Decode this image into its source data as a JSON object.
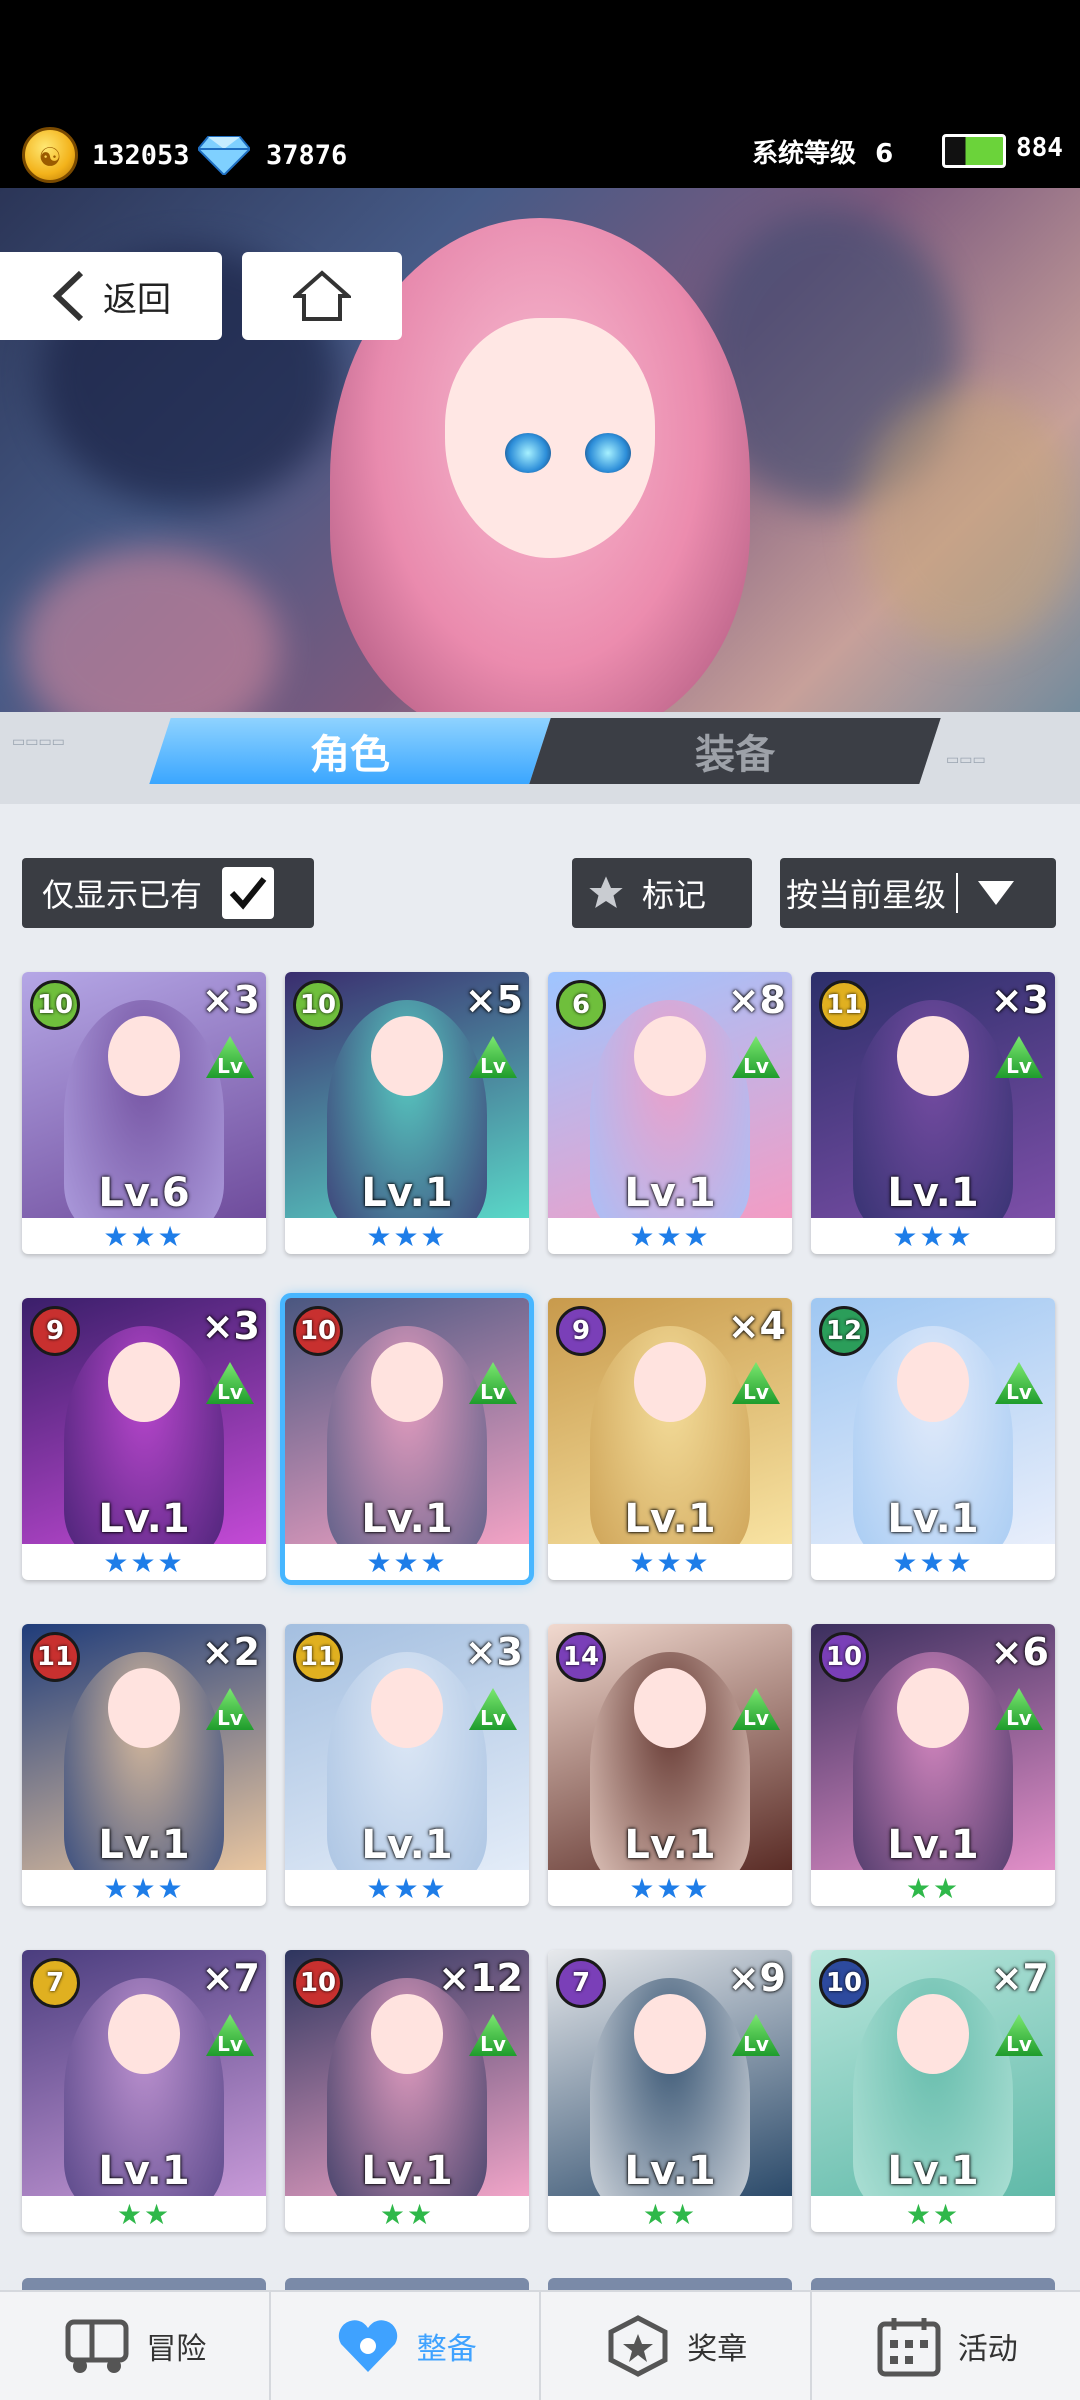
{
  "resources": {
    "gold": "132053",
    "diamonds": "37876",
    "system_level_label": "系统等级",
    "system_level": "6",
    "energy": "884"
  },
  "nav_buttons": {
    "back_label": "返回"
  },
  "tabs": [
    {
      "label": "角色",
      "active": true
    },
    {
      "label": "装备",
      "active": false
    }
  ],
  "filters": {
    "owned_only_label": "仅显示已有",
    "owned_only_checked": true,
    "mark_label": "标记",
    "sort_label": "按当前星级"
  },
  "characters": [
    {
      "level": "10",
      "count": "×3",
      "lv": "Lv.6",
      "stars": "★★★",
      "star_color": "#1e7de8",
      "badge_color": "#6fbf3c",
      "palette": [
        "#b5a7e6",
        "#6f4c9c"
      ]
    },
    {
      "level": "10",
      "count": "×5",
      "lv": "Lv.1",
      "stars": "★★★",
      "star_color": "#1e7de8",
      "badge_color": "#6fbf3c",
      "palette": [
        "#3a2d6e",
        "#5ad8c8"
      ]
    },
    {
      "level": "6",
      "count": "×8",
      "lv": "Lv.1",
      "stars": "★★★",
      "star_color": "#1e7de8",
      "badge_color": "#6fbf3c",
      "palette": [
        "#9ec5ff",
        "#f39cc4"
      ]
    },
    {
      "level": "11",
      "count": "×3",
      "lv": "Lv.1",
      "stars": "★★★",
      "star_color": "#1e7de8",
      "badge_color": "#e0b020",
      "palette": [
        "#2c2f6a",
        "#7d4fa8"
      ]
    },
    {
      "level": "9",
      "count": "×3",
      "lv": "Lv.1",
      "stars": "★★★",
      "star_color": "#1e7de8",
      "badge_color": "#c8302f",
      "palette": [
        "#3a1f6a",
        "#c44ad6"
      ]
    },
    {
      "level": "10",
      "count": "",
      "lv": "Lv.1",
      "stars": "★★★",
      "star_color": "#1e7de8",
      "badge_color": "#c8302f",
      "palette": [
        "#4a5780",
        "#f3a3c5"
      ],
      "selected": true
    },
    {
      "level": "9",
      "count": "×4",
      "lv": "Lv.1",
      "stars": "★★★",
      "star_color": "#1e7de8",
      "badge_color": "#7a3fb8",
      "palette": [
        "#c89a4c",
        "#f8e3a2"
      ]
    },
    {
      "level": "12",
      "count": "",
      "lv": "Lv.1",
      "stars": "★★★",
      "star_color": "#1e7de8",
      "badge_color": "#2b9e5a",
      "palette": [
        "#9fc7f2",
        "#e8eefb"
      ]
    },
    {
      "level": "11",
      "count": "×2",
      "lv": "Lv.1",
      "stars": "★★★",
      "star_color": "#1e7de8",
      "badge_color": "#c8302f",
      "palette": [
        "#1f3c7a",
        "#e9c6a0"
      ]
    },
    {
      "level": "11",
      "count": "×3",
      "lv": "Lv.1",
      "stars": "★★★",
      "star_color": "#1e7de8",
      "badge_color": "#e0b020",
      "palette": [
        "#a4bfe0",
        "#e3ecf8"
      ]
    },
    {
      "level": "14",
      "count": "",
      "lv": "Lv.1",
      "stars": "★★★",
      "star_color": "#1e7de8",
      "badge_color": "#7a3fb8",
      "palette": [
        "#f1d9cf",
        "#5a2c26"
      ]
    },
    {
      "level": "10",
      "count": "×6",
      "lv": "Lv.1",
      "stars": "★★",
      "star_color": "#2fb84a",
      "badge_color": "#7a3fb8",
      "palette": [
        "#3b2f5e",
        "#e28fc8"
      ]
    },
    {
      "level": "7",
      "count": "×7",
      "lv": "Lv.1",
      "stars": "★★",
      "star_color": "#2fb84a",
      "badge_color": "#e0b020",
      "palette": [
        "#4a3d7e",
        "#c89ad8"
      ]
    },
    {
      "level": "10",
      "count": "×12",
      "lv": "Lv.1",
      "stars": "★★",
      "star_color": "#2fb84a",
      "badge_color": "#c8302f",
      "palette": [
        "#2d355e",
        "#f1a5c8"
      ]
    },
    {
      "level": "7",
      "count": "×9",
      "lv": "Lv.1",
      "stars": "★★",
      "star_color": "#2fb84a",
      "badge_color": "#7a3fb8",
      "palette": [
        "#e7e9ec",
        "#2b4a6a"
      ]
    },
    {
      "level": "10",
      "count": "×7",
      "lv": "Lv.1",
      "stars": "★★",
      "star_color": "#2fb84a",
      "badge_color": "#2d4a9e",
      "palette": [
        "#b9e6dc",
        "#5fb9a8"
      ]
    }
  ],
  "bottom_nav": [
    {
      "label": "冒险",
      "icon": "truck-icon",
      "active": false
    },
    {
      "label": "整备",
      "icon": "heart-badge-icon",
      "active": true
    },
    {
      "label": "奖章",
      "icon": "medal-icon",
      "active": false
    },
    {
      "label": "活动",
      "icon": "calendar-icon",
      "active": false
    }
  ]
}
